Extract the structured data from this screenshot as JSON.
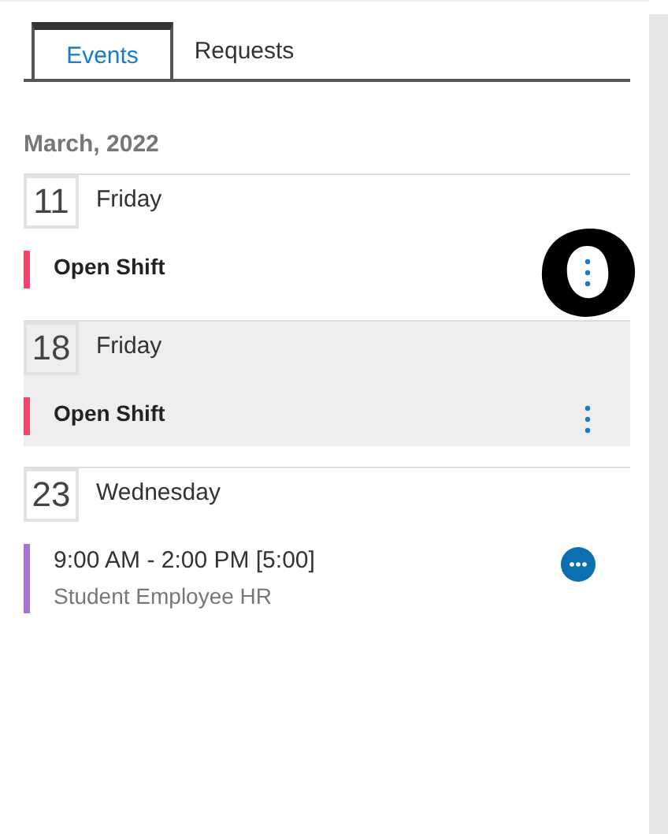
{
  "tabs": [
    {
      "label": "Events",
      "selected": true
    },
    {
      "label": "Requests",
      "selected": false
    }
  ],
  "month": "March, 2022",
  "days": [
    {
      "number": "11",
      "weekday": "Friday",
      "selected": false,
      "events": [
        {
          "kind": "open_shift",
          "title": "Open Shift",
          "color": "#f0466e",
          "circled": true
        }
      ]
    },
    {
      "number": "18",
      "weekday": "Friday",
      "selected": true,
      "events": [
        {
          "kind": "open_shift",
          "title": "Open Shift",
          "color": "#f0466e",
          "circled": false
        }
      ]
    },
    {
      "number": "23",
      "weekday": "Wednesday",
      "selected": false,
      "events": [
        {
          "kind": "shift",
          "title": "9:00 AM - 2:00 PM [5:00]",
          "subtitle": "Student Employee HR",
          "color": "#a971d1"
        }
      ]
    }
  ]
}
